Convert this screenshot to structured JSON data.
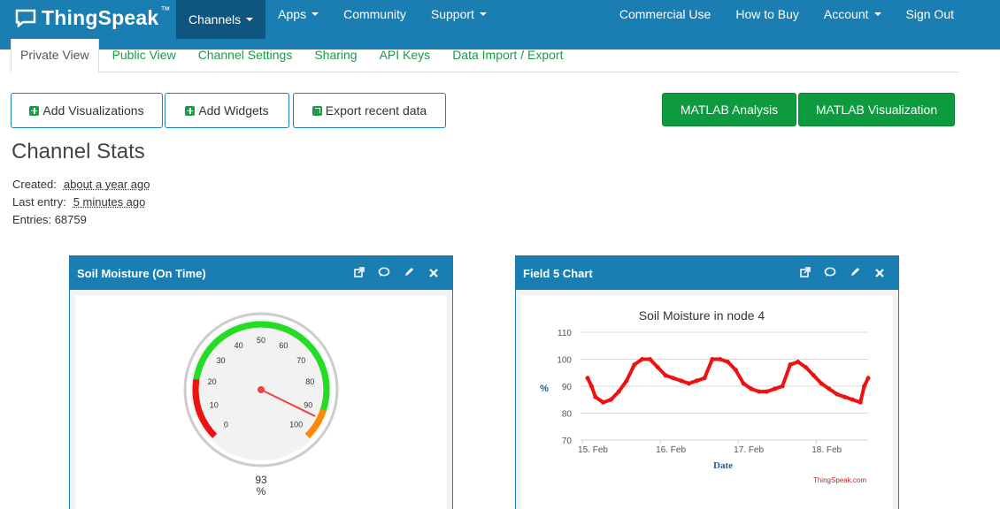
{
  "nav": {
    "brand": "ThingSpeak",
    "brand_tm": "™",
    "items_left": [
      "Channels",
      "Apps",
      "Community",
      "Support"
    ],
    "items_right": [
      "Commercial Use",
      "How to Buy",
      "Account",
      "Sign Out"
    ]
  },
  "tabs": [
    "Private View",
    "Public View",
    "Channel Settings",
    "Sharing",
    "API Keys",
    "Data Import / Export"
  ],
  "buttons": {
    "add_visualizations": "Add Visualizations",
    "add_widgets": "Add Widgets",
    "export_recent": "Export recent data",
    "matlab_analysis": "MATLAB Analysis",
    "matlab_visualization": "MATLAB Visualization"
  },
  "stats": {
    "title": "Channel Stats",
    "created_label": "Created:",
    "created_value": "about a year ago",
    "last_entry_label": "Last entry:",
    "last_entry_value": "5 minutes ago",
    "entries_label": "Entries:",
    "entries_value": "68759"
  },
  "gauge_widget": {
    "title": "Soil Moisture (On Time)",
    "value": "93",
    "unit": "%",
    "ticks": [
      "0",
      "10",
      "20",
      "30",
      "40",
      "50",
      "60",
      "70",
      "80",
      "90",
      "100"
    ]
  },
  "chart_widget": {
    "title": "Field 5 Chart",
    "credit": "ThingSpeak.com"
  },
  "colors": {
    "nav_bg": "#1B7EB2",
    "nav_active": "#0E5680",
    "accent_green": "#0E9A3E",
    "gauge_green": "#22DD22",
    "gauge_red": "#EE1111",
    "gauge_orange": "#FF8800",
    "series_red": "#EE1111"
  },
  "chart_data": {
    "type": "line",
    "title": "Soil Moisture in node 4",
    "xlabel": "Date",
    "ylabel": "%",
    "ylim": [
      70,
      110
    ],
    "yticks": [
      "70",
      "80",
      "90",
      "100",
      "110"
    ],
    "xticks": [
      "15. Feb",
      "16. Feb",
      "17. Feb",
      "18. Feb"
    ],
    "series": [
      {
        "values": [
          [
            0.0,
            93
          ],
          [
            0.05,
            90
          ],
          [
            0.1,
            86
          ],
          [
            0.2,
            84
          ],
          [
            0.3,
            85
          ],
          [
            0.4,
            88
          ],
          [
            0.5,
            92
          ],
          [
            0.6,
            98
          ],
          [
            0.7,
            100
          ],
          [
            0.8,
            100
          ],
          [
            0.9,
            97
          ],
          [
            1.0,
            94
          ],
          [
            1.1,
            93
          ],
          [
            1.2,
            92
          ],
          [
            1.3,
            91
          ],
          [
            1.4,
            92
          ],
          [
            1.5,
            93
          ],
          [
            1.6,
            100
          ],
          [
            1.7,
            100
          ],
          [
            1.8,
            99
          ],
          [
            1.9,
            96
          ],
          [
            2.0,
            91
          ],
          [
            2.1,
            89
          ],
          [
            2.2,
            88
          ],
          [
            2.3,
            88
          ],
          [
            2.4,
            89
          ],
          [
            2.5,
            90
          ],
          [
            2.6,
            98
          ],
          [
            2.7,
            99
          ],
          [
            2.8,
            97
          ],
          [
            2.9,
            94
          ],
          [
            3.0,
            91
          ],
          [
            3.1,
            89
          ],
          [
            3.2,
            87
          ],
          [
            3.3,
            86
          ],
          [
            3.4,
            85
          ],
          [
            3.5,
            84
          ],
          [
            3.55,
            90
          ],
          [
            3.6,
            93
          ]
        ]
      }
    ]
  }
}
